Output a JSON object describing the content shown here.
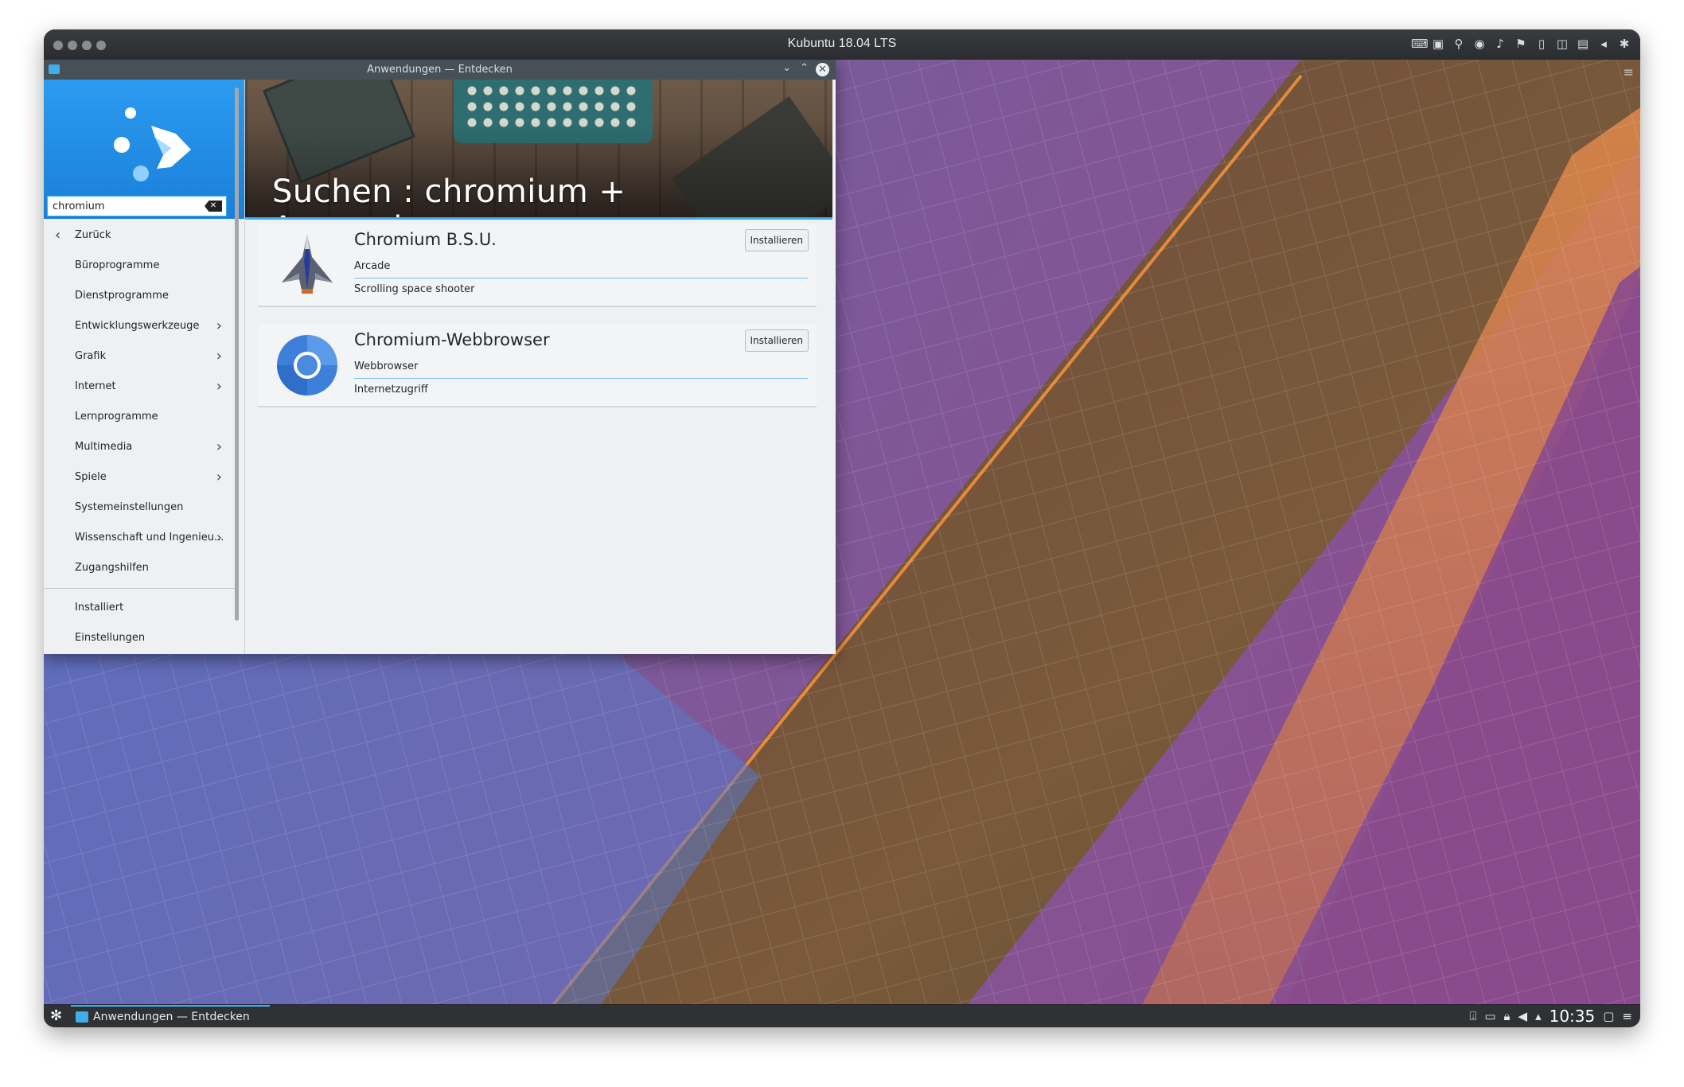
{
  "vm": {
    "title": "Kubuntu 18.04 LTS"
  },
  "window": {
    "title": "Anwendungen — Entdecken"
  },
  "sidebar": {
    "search": {
      "value": "chromium"
    },
    "back_label": "Zurück",
    "categories": [
      {
        "label": "Büroprogramme",
        "has_submenu": false
      },
      {
        "label": "Dienstprogramme",
        "has_submenu": false
      },
      {
        "label": "Entwicklungswerkzeuge",
        "has_submenu": true
      },
      {
        "label": "Grafik",
        "has_submenu": true
      },
      {
        "label": "Internet",
        "has_submenu": true
      },
      {
        "label": "Lernprogramme",
        "has_submenu": false
      },
      {
        "label": "Multimedia",
        "has_submenu": true
      },
      {
        "label": "Spiele",
        "has_submenu": true
      },
      {
        "label": "Systemeinstellungen",
        "has_submenu": false
      },
      {
        "label": "Wissenschaft und Ingenieu...",
        "has_submenu": true
      },
      {
        "label": "Zugangshilfen",
        "has_submenu": false
      }
    ],
    "bottom": [
      {
        "label": "Installiert"
      },
      {
        "label": "Einstellungen"
      }
    ]
  },
  "header": {
    "title": "Suchen : chromium + Anwendungen"
  },
  "results": [
    {
      "name": "Chromium B.S.U.",
      "category": "Arcade",
      "description": "Scrolling space shooter",
      "button": "Installieren",
      "icon": "spaceship-icon"
    },
    {
      "name": "Chromium-Webbrowser",
      "category": "Webbrowser",
      "description": "Internetzugriff",
      "button": "Installieren",
      "icon": "chromium-icon"
    }
  ],
  "taskbar": {
    "task_label": "Anwendungen — Entdecken",
    "clock": "10:35"
  },
  "colors": {
    "accent": "#3daee9",
    "window_bg": "#eff0f1",
    "titlebar": "#475057"
  }
}
